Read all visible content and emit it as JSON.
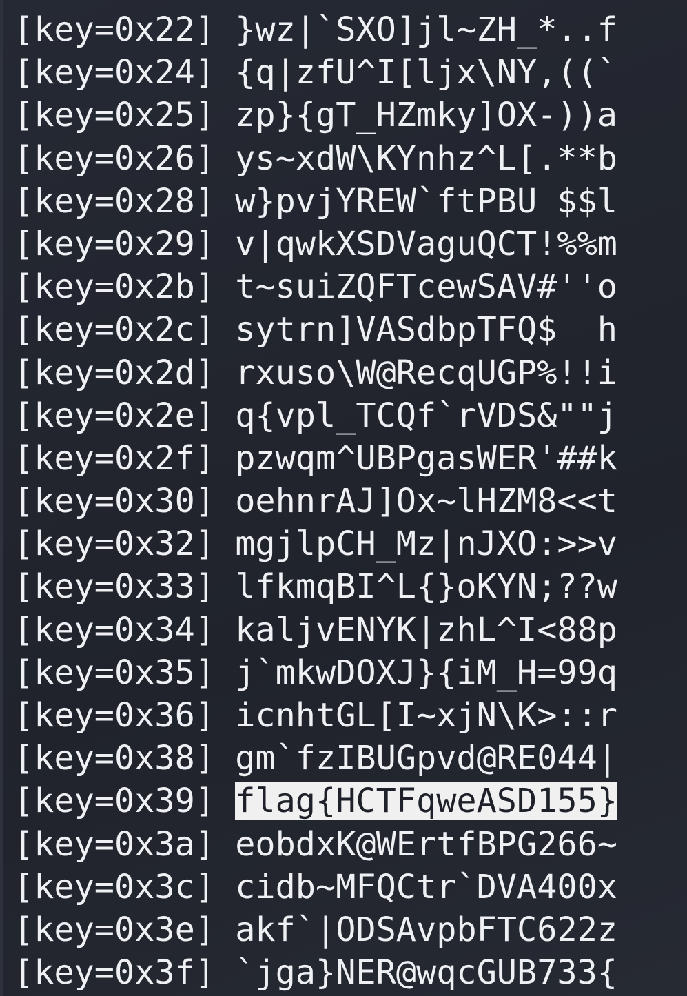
{
  "terminal": {
    "highlight_color": "#f0f0f0",
    "lines": [
      {
        "key": "[key=0x22]",
        "value": "}wz|`SXO]jl~ZH_*..f",
        "highlighted": false
      },
      {
        "key": "[key=0x24]",
        "value": "{q|zfU^I[ljx\\NY,((`",
        "highlighted": false
      },
      {
        "key": "[key=0x25]",
        "value": "zp}{gT_HZmky]OX-))a",
        "highlighted": false
      },
      {
        "key": "[key=0x26]",
        "value": "ys~xdW\\KYnhz^L[.**b",
        "highlighted": false
      },
      {
        "key": "[key=0x28]",
        "value": "w}pvjYREW`ftPBU $$l",
        "highlighted": false
      },
      {
        "key": "[key=0x29]",
        "value": "v|qwkXSDVaguQCT!%%m",
        "highlighted": false
      },
      {
        "key": "[key=0x2b]",
        "value": "t~suiZQFTcewSAV#''o",
        "highlighted": false
      },
      {
        "key": "[key=0x2c]",
        "value": "sytrn]VASdbpTFQ$  h",
        "highlighted": false
      },
      {
        "key": "[key=0x2d]",
        "value": "rxuso\\W@RecqUGP%!!i",
        "highlighted": false
      },
      {
        "key": "[key=0x2e]",
        "value": "q{vpl_TCQf`rVDS&\"\"j",
        "highlighted": false
      },
      {
        "key": "[key=0x2f]",
        "value": "pzwqm^UBPgasWER'##k",
        "highlighted": false
      },
      {
        "key": "[key=0x30]",
        "value": "oehnrAJ]Ox~lHZM8<<t",
        "highlighted": false
      },
      {
        "key": "[key=0x32]",
        "value": "mgjlpCH_Mz|nJXO:>>v",
        "highlighted": false
      },
      {
        "key": "[key=0x33]",
        "value": "lfkmqBI^L{}oKYN;??w",
        "highlighted": false
      },
      {
        "key": "[key=0x34]",
        "value": "kaljvENYK|zhL^I<88p",
        "highlighted": false
      },
      {
        "key": "[key=0x35]",
        "value": "j`mkwDOXJ}{iM_H=99q",
        "highlighted": false
      },
      {
        "key": "[key=0x36]",
        "value": "icnhtGL[I~xjN\\K>::r",
        "highlighted": false
      },
      {
        "key": "[key=0x38]",
        "value": "gm`fzIBUGpvd@RE044|",
        "highlighted": false
      },
      {
        "key": "[key=0x39]",
        "value": "flag{HCTFqweASD155}",
        "highlighted": true
      },
      {
        "key": "[key=0x3a]",
        "value": "eobdxK@WErtfBPG266~",
        "highlighted": false
      },
      {
        "key": "[key=0x3c]",
        "value": "cidb~MFQCtr`DVA400x",
        "highlighted": false
      },
      {
        "key": "[key=0x3e]",
        "value": "akf`|ODSAvpbFTC622z",
        "highlighted": false
      },
      {
        "key": "[key=0x3f]",
        "value": "`jga}NER@wqcGUB733{",
        "highlighted": false
      }
    ]
  }
}
